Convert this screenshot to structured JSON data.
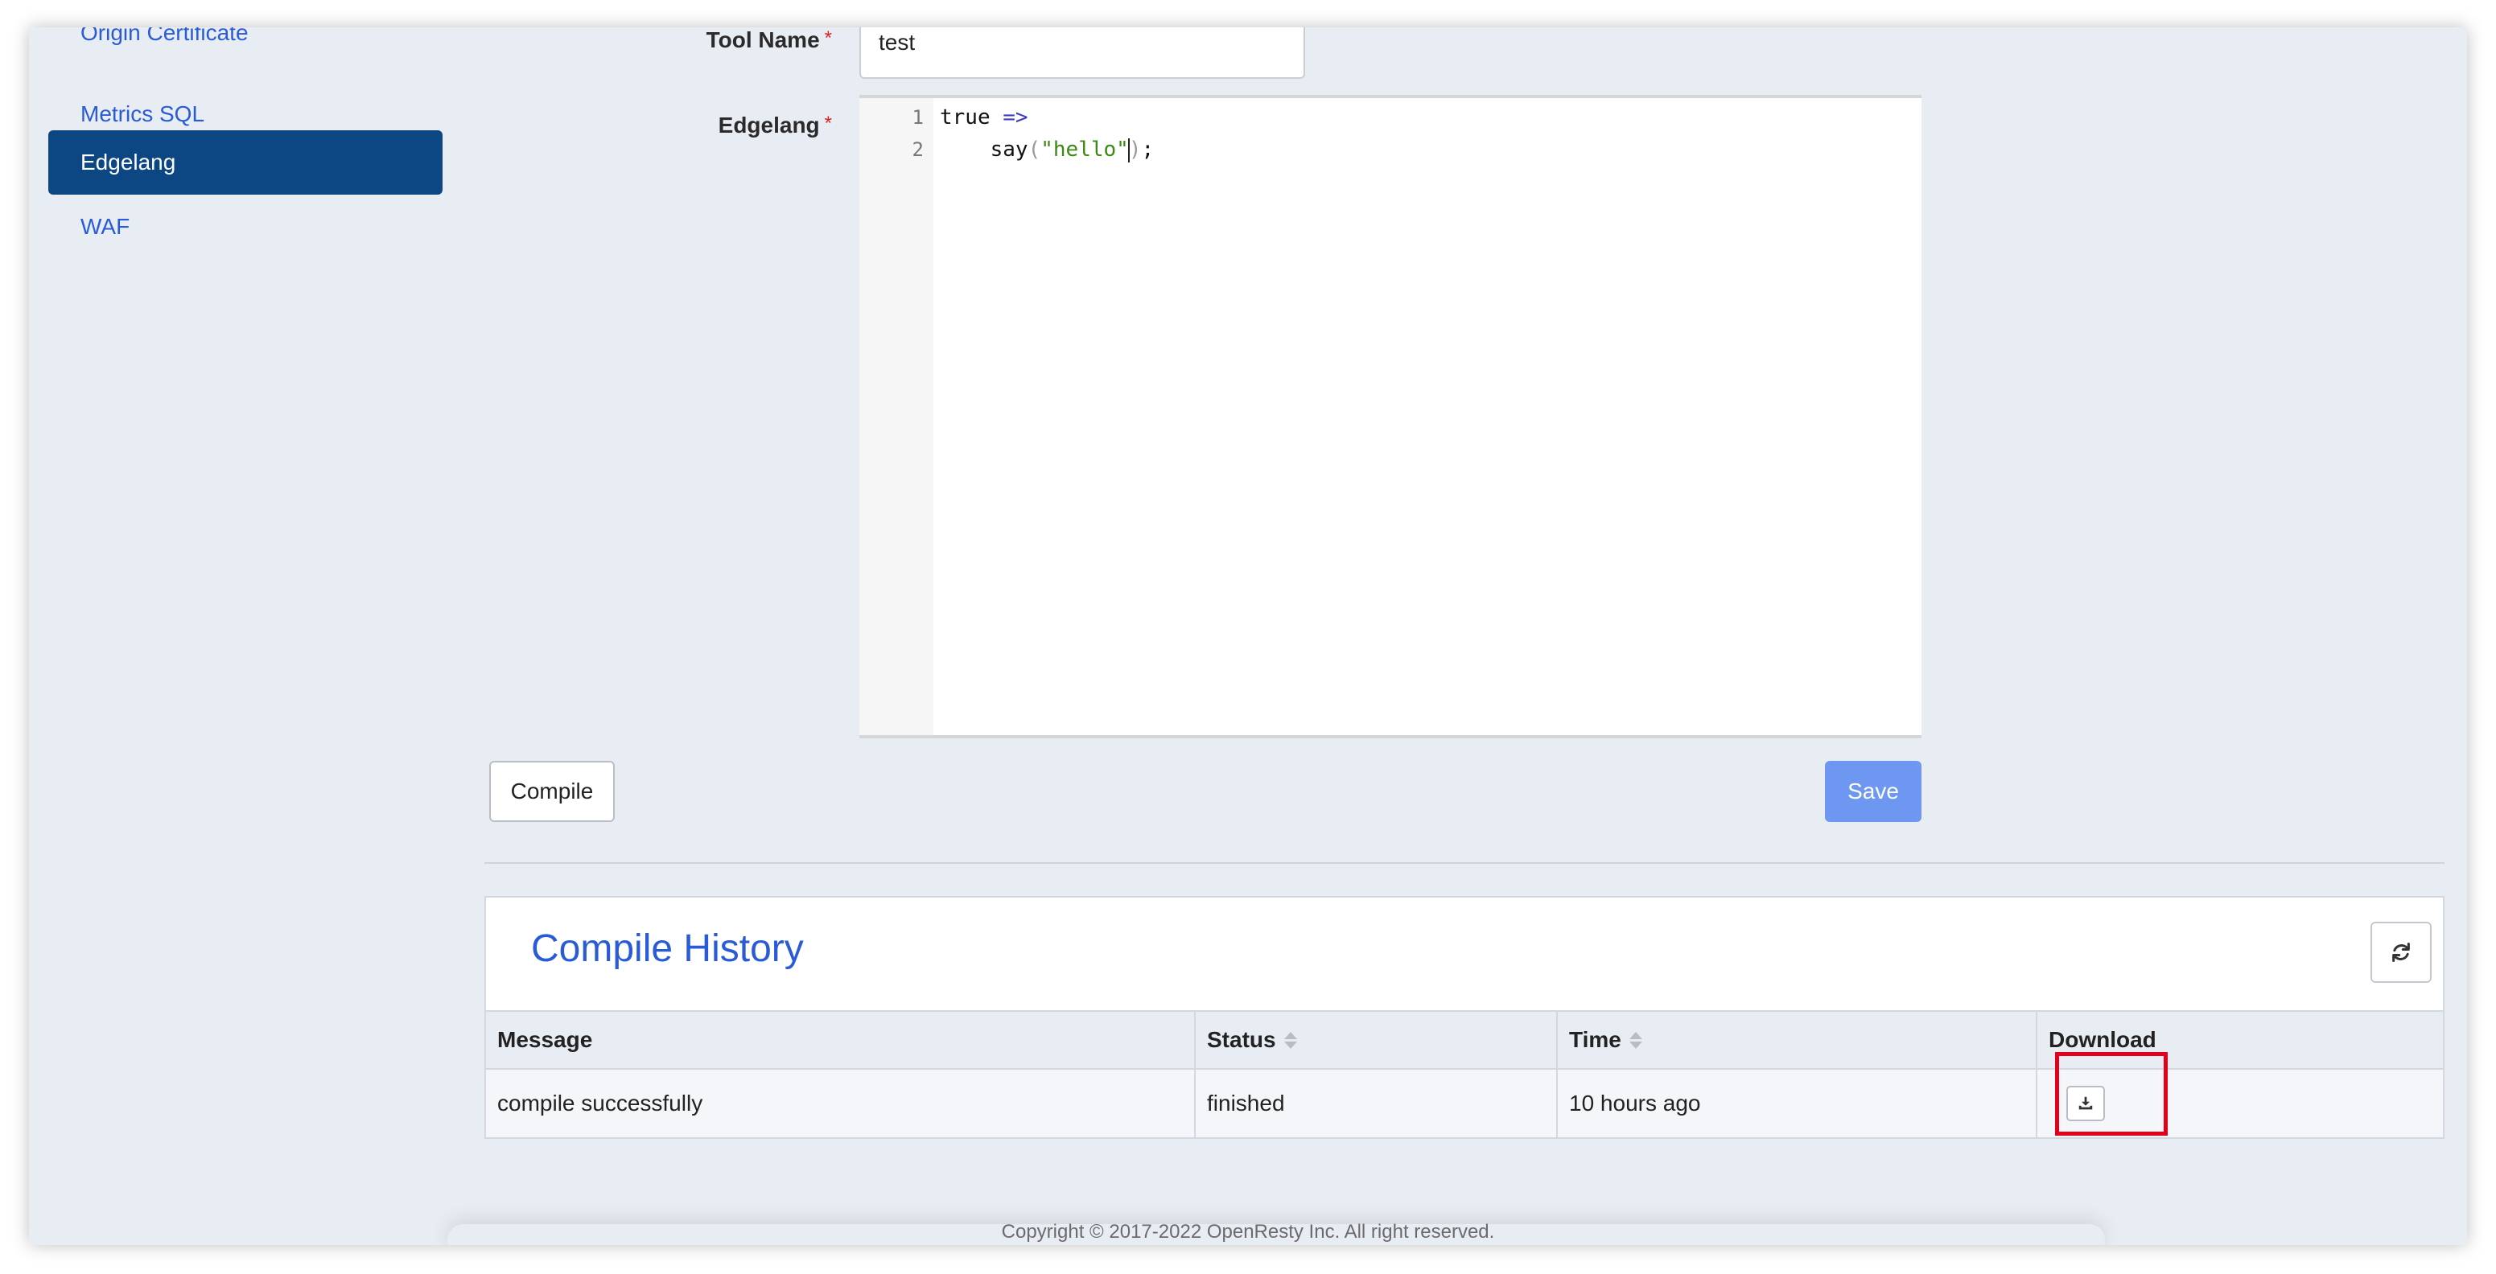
{
  "sidebar": {
    "items": [
      {
        "label": "Origin Certificate",
        "active": false
      },
      {
        "label": "Metrics SQL",
        "active": false
      },
      {
        "label": "Edgelang",
        "active": true
      },
      {
        "label": "WAF",
        "active": false
      }
    ]
  },
  "form": {
    "tool_name_label": "Tool Name",
    "tool_name_value": "test",
    "edgelang_label": "Edgelang",
    "required_mark": "*",
    "editor": {
      "line_numbers": [
        "1",
        "2"
      ],
      "line1": {
        "keyword": "true",
        "op": "=>"
      },
      "line2": {
        "indent": "    ",
        "fn": "say",
        "open": "(",
        "str": "\"hello\"",
        "close": ")",
        "semi": ";"
      }
    },
    "compile_label": "Compile",
    "save_label": "Save"
  },
  "history": {
    "title": "Compile History",
    "columns": [
      "Message",
      "Status",
      "Time",
      "Download"
    ],
    "rows": [
      {
        "message": "compile successfully",
        "status": "finished",
        "time": "10 hours ago"
      }
    ]
  },
  "footer": {
    "text": "Copyright © 2017-2022 OpenResty Inc. All right reserved."
  },
  "colors": {
    "accent": "#2a5bd7",
    "sidebar_active": "#0d4783",
    "save_button": "#6e97f2",
    "highlight": "#e3001b",
    "required": "#e02020"
  },
  "icons": {
    "refresh": "refresh-icon",
    "download": "download-icon"
  }
}
